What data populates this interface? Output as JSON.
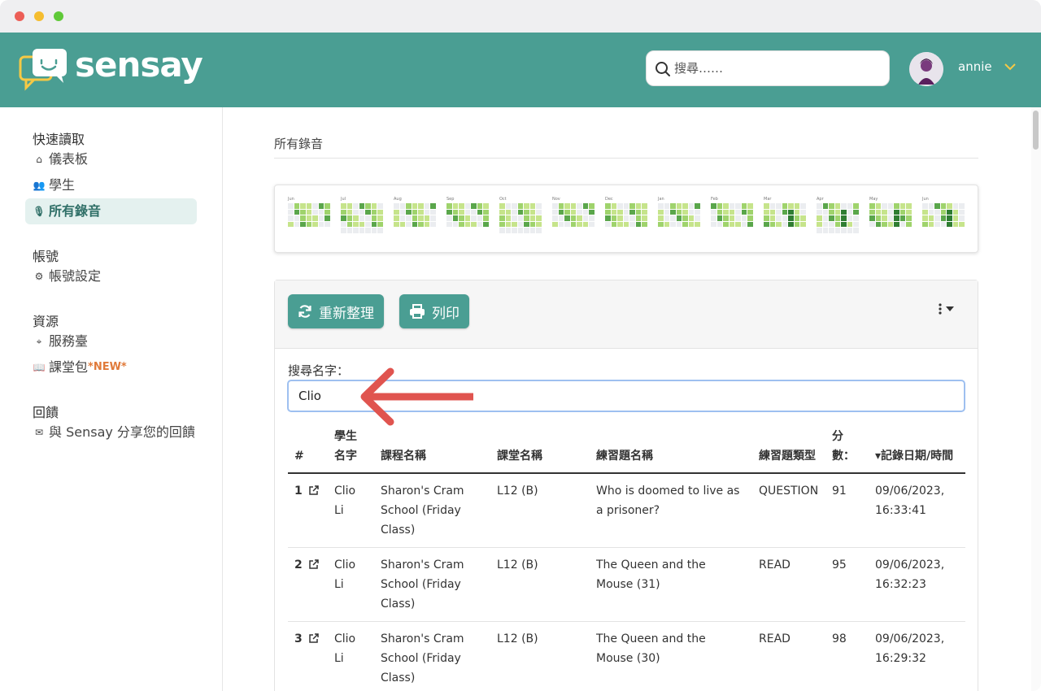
{
  "app": {
    "name": "sensay"
  },
  "search": {
    "placeholder": "搜尋……"
  },
  "user": {
    "name": "annie"
  },
  "sidebar": {
    "sections": [
      {
        "title": "快速讀取",
        "items": [
          {
            "label": "儀表板",
            "icon": "home-icon"
          },
          {
            "label": "學生",
            "icon": "people-icon"
          },
          {
            "label": "所有錄音",
            "icon": "mic-icon",
            "active": true
          }
        ]
      },
      {
        "title": "帳號",
        "items": [
          {
            "label": "帳號設定",
            "icon": "gear-icon"
          }
        ]
      },
      {
        "title": "資源",
        "items": [
          {
            "label": "服務臺",
            "icon": "location-pin-icon"
          },
          {
            "label": "課堂包",
            "icon": "book-icon",
            "badge": "*NEW*"
          }
        ]
      },
      {
        "title": "回饋",
        "items": [
          {
            "label": "與 Sensay 分享您的回饋",
            "icon": "mail-icon"
          }
        ]
      }
    ]
  },
  "main": {
    "page_title": "所有錄音",
    "heatmap": {
      "months": [
        "Jun",
        "Jul",
        "Aug",
        "Sep",
        "Oct",
        "Nov",
        "Dec",
        "Jan",
        "Feb",
        "Mar",
        "Apr",
        "May",
        "Jun"
      ],
      "colors": [
        "#ebedf0",
        "#c6e48b",
        "#9fd36c",
        "#5aa64b",
        "#2f7d32"
      ]
    },
    "toolbar": {
      "refresh_label": "重新整理",
      "print_label": "列印"
    },
    "name_search": {
      "label": "搜尋名字：",
      "value": "Clio"
    },
    "table": {
      "headers": [
        "#",
        "學生名字",
        "課程名稱",
        "課堂名稱",
        "練習題名稱",
        "練習題類型",
        "分數：",
        "▾記錄日期/時間"
      ],
      "rows": [
        {
          "num": "1",
          "student": "Clio Li",
          "course": "Sharon's Cram School (Friday Class)",
          "lesson": "L12 (B)",
          "exercise": "Who is doomed to live as a prisoner?",
          "type": "QUESTION",
          "score": "91",
          "date": "09/06/2023, 16:33:41"
        },
        {
          "num": "2",
          "student": "Clio Li",
          "course": "Sharon's Cram School (Friday Class)",
          "lesson": "L12 (B)",
          "exercise": "The Queen and the Mouse (31)",
          "type": "READ",
          "score": "95",
          "date": "09/06/2023, 16:32:23"
        },
        {
          "num": "3",
          "student": "Clio Li",
          "course": "Sharon's Cram School (Friday Class)",
          "lesson": "L12 (B)",
          "exercise": "The Queen and the Mouse (30)",
          "type": "READ",
          "score": "98",
          "date": "09/06/2023, 16:29:32"
        }
      ]
    }
  }
}
